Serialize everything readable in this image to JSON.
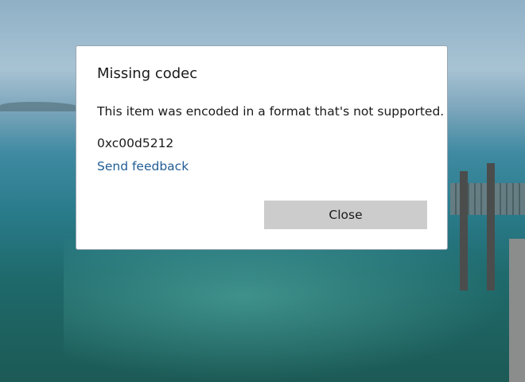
{
  "dialog": {
    "title": "Missing codec",
    "message": "This item was encoded in a format that's not supported.",
    "error_code": "0xc00d5212",
    "link_label": "Send feedback",
    "close_label": "Close"
  },
  "colors": {
    "link": "#1f5d94",
    "button_bg": "#cccccc",
    "dialog_bg": "#ffffff"
  }
}
